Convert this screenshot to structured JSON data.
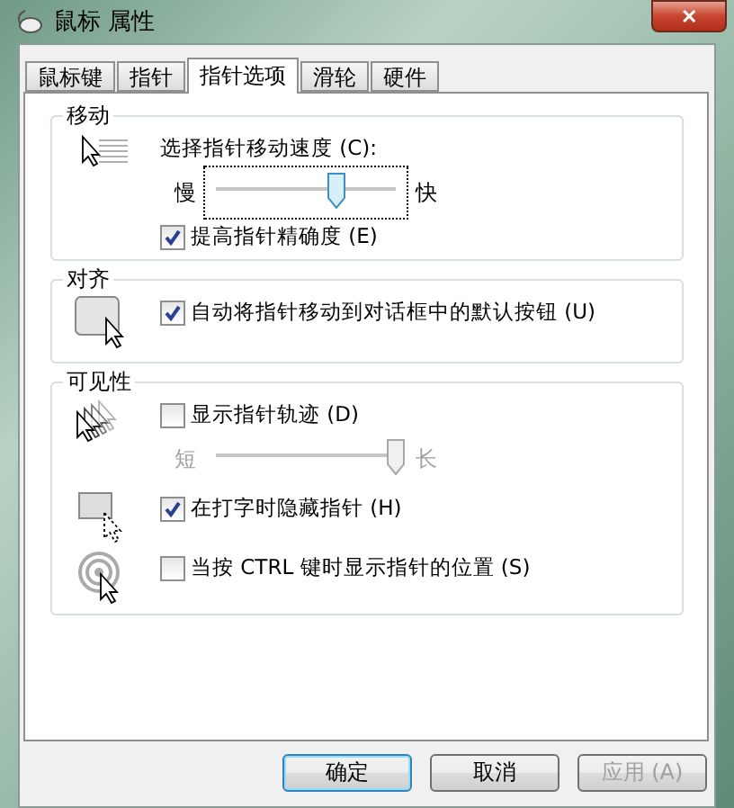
{
  "window": {
    "title": "鼠标 属性",
    "close": "✕"
  },
  "tabs": [
    {
      "label": "鼠标键",
      "selected": false
    },
    {
      "label": "指针",
      "selected": false
    },
    {
      "label": "指针选项",
      "selected": true
    },
    {
      "label": "滑轮",
      "selected": false
    },
    {
      "label": "硬件",
      "selected": false
    }
  ],
  "groups": [
    {
      "title": "移动",
      "blocks": [
        {
          "rows": [
            {
              "kind": "label",
              "text": "选择指针移动速度 (C):"
            },
            {
              "kind": "slider",
              "min_label": "慢",
              "max_label": "快",
              "level": 0.67,
              "disabled": false,
              "focused": true
            },
            {
              "kind": "checkbox",
              "label": "提高指针精确度 (E)",
              "checked": true
            }
          ]
        }
      ]
    },
    {
      "title": "对齐",
      "blocks": [
        {
          "rows": [
            {
              "kind": "checkbox",
              "label": "自动将指针移动到对话框中的默认按钮 (U)",
              "checked": true
            }
          ]
        }
      ]
    },
    {
      "title": "可见性",
      "blocks": [
        {
          "rows": [
            {
              "kind": "checkbox",
              "label": "显示指针轨迹 (D)",
              "checked": false
            },
            {
              "kind": "slider",
              "min_label": "短",
              "max_label": "长",
              "level": 1.0,
              "disabled": true,
              "focused": false
            }
          ]
        },
        {
          "rows": [
            {
              "kind": "checkbox",
              "label": "在打字时隐藏指针 (H)",
              "checked": true
            }
          ]
        },
        {
          "rows": [
            {
              "kind": "checkbox",
              "label": "当按 CTRL 键时显示指针的位置 (S)",
              "checked": false
            }
          ]
        }
      ]
    }
  ],
  "buttons": [
    {
      "label": "确定",
      "default": true,
      "disabled": false
    },
    {
      "label": "取消",
      "default": false,
      "disabled": false
    },
    {
      "label": "应用 (A)",
      "default": false,
      "disabled": true
    }
  ]
}
